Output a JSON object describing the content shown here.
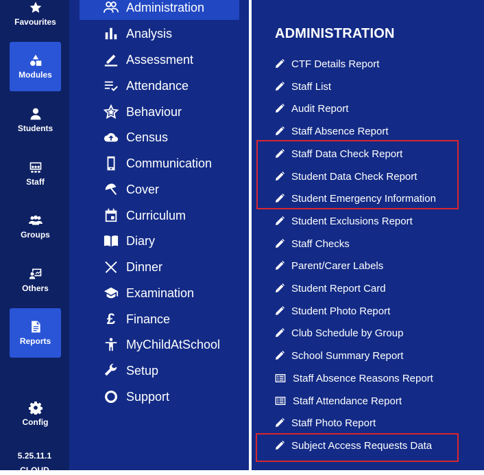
{
  "rail": {
    "items": [
      {
        "label": "Favourites",
        "icon": "star-icon"
      },
      {
        "label": "Modules",
        "icon": "modules-icon",
        "active": true
      },
      {
        "label": "Students",
        "icon": "person-icon"
      },
      {
        "label": "Staff",
        "icon": "staff-icon"
      },
      {
        "label": "Groups",
        "icon": "groups-icon"
      },
      {
        "label": "Others",
        "icon": "others-icon"
      },
      {
        "label": "Reports",
        "icon": "document-icon",
        "active": true
      },
      {
        "label": "Config",
        "icon": "gear-icon"
      }
    ],
    "version": "5.25.11.1",
    "version_sub": "CLOUD"
  },
  "modules": {
    "items": [
      {
        "label": "Administration",
        "icon": "people-icon",
        "active": true
      },
      {
        "label": "Analysis",
        "icon": "bar-chart-icon"
      },
      {
        "label": "Assessment",
        "icon": "pen-line-icon"
      },
      {
        "label": "Attendance",
        "icon": "checklist-icon"
      },
      {
        "label": "Behaviour",
        "icon": "star-outline-icon"
      },
      {
        "label": "Census",
        "icon": "cloud-upload-icon"
      },
      {
        "label": "Communication",
        "icon": "phone-icon"
      },
      {
        "label": "Cover",
        "icon": "umbrella-icon"
      },
      {
        "label": "Curriculum",
        "icon": "calendar-icon"
      },
      {
        "label": "Diary",
        "icon": "book-icon"
      },
      {
        "label": "Dinner",
        "icon": "cutlery-icon"
      },
      {
        "label": "Examination",
        "icon": "graduation-cap-icon"
      },
      {
        "label": "Finance",
        "icon": "pound-icon"
      },
      {
        "label": "MyChildAtSchool",
        "icon": "accessibility-icon"
      },
      {
        "label": "Setup",
        "icon": "wrench-icon"
      },
      {
        "label": "Support",
        "icon": "circle-icon"
      }
    ]
  },
  "reports": {
    "title": "ADMINISTRATION",
    "items": [
      {
        "label": "CTF Details Report",
        "icon": "pencil-icon"
      },
      {
        "label": "Staff List",
        "icon": "pencil-icon"
      },
      {
        "label": "Audit Report",
        "icon": "pencil-icon"
      },
      {
        "label": "Staff Absence Report",
        "icon": "pencil-icon"
      },
      {
        "label": "Staff Data Check Report",
        "icon": "pencil-icon"
      },
      {
        "label": "Student Data Check Report",
        "icon": "pencil-icon"
      },
      {
        "label": "Student Emergency Information",
        "icon": "pencil-icon"
      },
      {
        "label": "Student Exclusions Report",
        "icon": "pencil-icon"
      },
      {
        "label": "Staff Checks",
        "icon": "pencil-icon"
      },
      {
        "label": "Parent/Carer Labels",
        "icon": "pencil-icon"
      },
      {
        "label": "Student Report Card",
        "icon": "pencil-icon"
      },
      {
        "label": "Student Photo Report",
        "icon": "pencil-icon"
      },
      {
        "label": "Club Schedule by Group",
        "icon": "pencil-icon"
      },
      {
        "label": "School Summary Report",
        "icon": "pencil-icon"
      },
      {
        "label": "Staff Absence Reasons Report",
        "icon": "list-icon"
      },
      {
        "label": "Staff Attendance Report",
        "icon": "list-icon"
      },
      {
        "label": "Staff Photo Report",
        "icon": "pencil-icon"
      },
      {
        "label": "Subject Access Requests Data",
        "icon": "pencil-icon"
      }
    ]
  },
  "colors": {
    "rail_bg": "#0e2163",
    "panel_bg": "#132b86",
    "active_bg": "#2a55d6",
    "highlight": "#d9262e"
  }
}
